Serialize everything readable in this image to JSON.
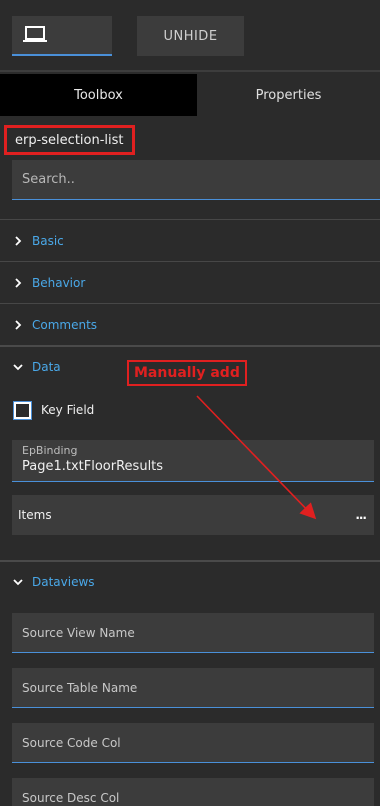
{
  "toolbar": {
    "device_icon": "laptop-icon",
    "unhide_label": "UNHIDE"
  },
  "tabs": [
    {
      "label": "Toolbox",
      "active": true
    },
    {
      "label": "Properties",
      "active": false
    }
  ],
  "component": {
    "name": "erp-selection-list"
  },
  "search": {
    "placeholder": "Search.."
  },
  "sections": {
    "basic": "Basic",
    "behavior": "Behavior",
    "comments": "Comments",
    "data": "Data",
    "dataviews": "Dataviews"
  },
  "data_section": {
    "key_field_label": "Key Field",
    "key_field_checked": false,
    "epbinding_label": "EpBinding",
    "epbinding_value": "Page1.txtFloorResults",
    "items_label": "Items",
    "items_more": "..."
  },
  "dataviews_section": {
    "source_view_name": "Source View Name",
    "source_table_name": "Source Table Name",
    "source_code_col": "Source Code Col",
    "source_desc_col": "Source Desc Col"
  },
  "annotation": {
    "text": "Manually add",
    "color": "#e02020"
  },
  "colors": {
    "background": "#2b2b2b",
    "field": "#3c3c3c",
    "accent": "#4a90d9",
    "section_label": "#4aa8e8"
  }
}
